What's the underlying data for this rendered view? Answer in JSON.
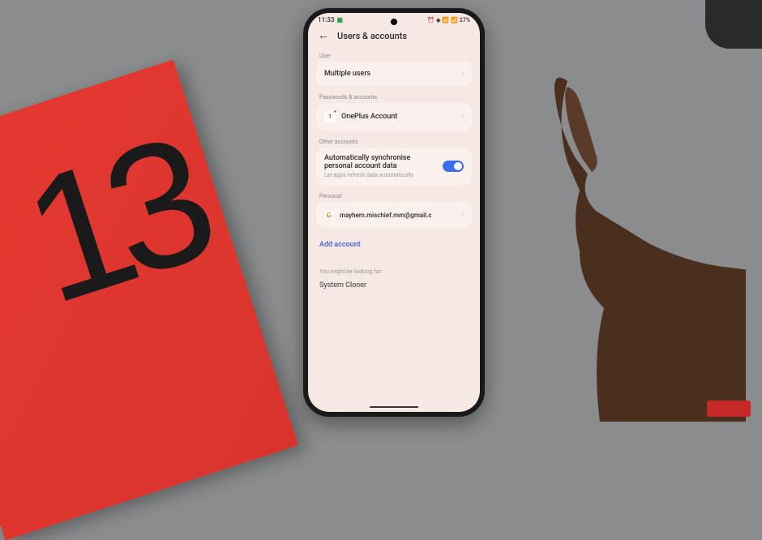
{
  "status": {
    "time": "11:33",
    "battery": "27%"
  },
  "header": {
    "title": "Users & accounts"
  },
  "sections": {
    "user": {
      "label": "User",
      "item": "Multiple users"
    },
    "passwords": {
      "label": "Passwords & accounts",
      "item": "OnePlus Account"
    },
    "other": {
      "label": "Other accounts",
      "sync_title": "Automatically synchronise personal account data",
      "sync_sub": "Let apps refresh data automatically",
      "sync_enabled": true
    },
    "personal": {
      "label": "Personal",
      "email": "mayhem.mischief.mm@gmail.c",
      "add": "Add account"
    },
    "looking": {
      "label": "You might be looking for:",
      "item": "System Cloner"
    }
  },
  "box_number": "13"
}
